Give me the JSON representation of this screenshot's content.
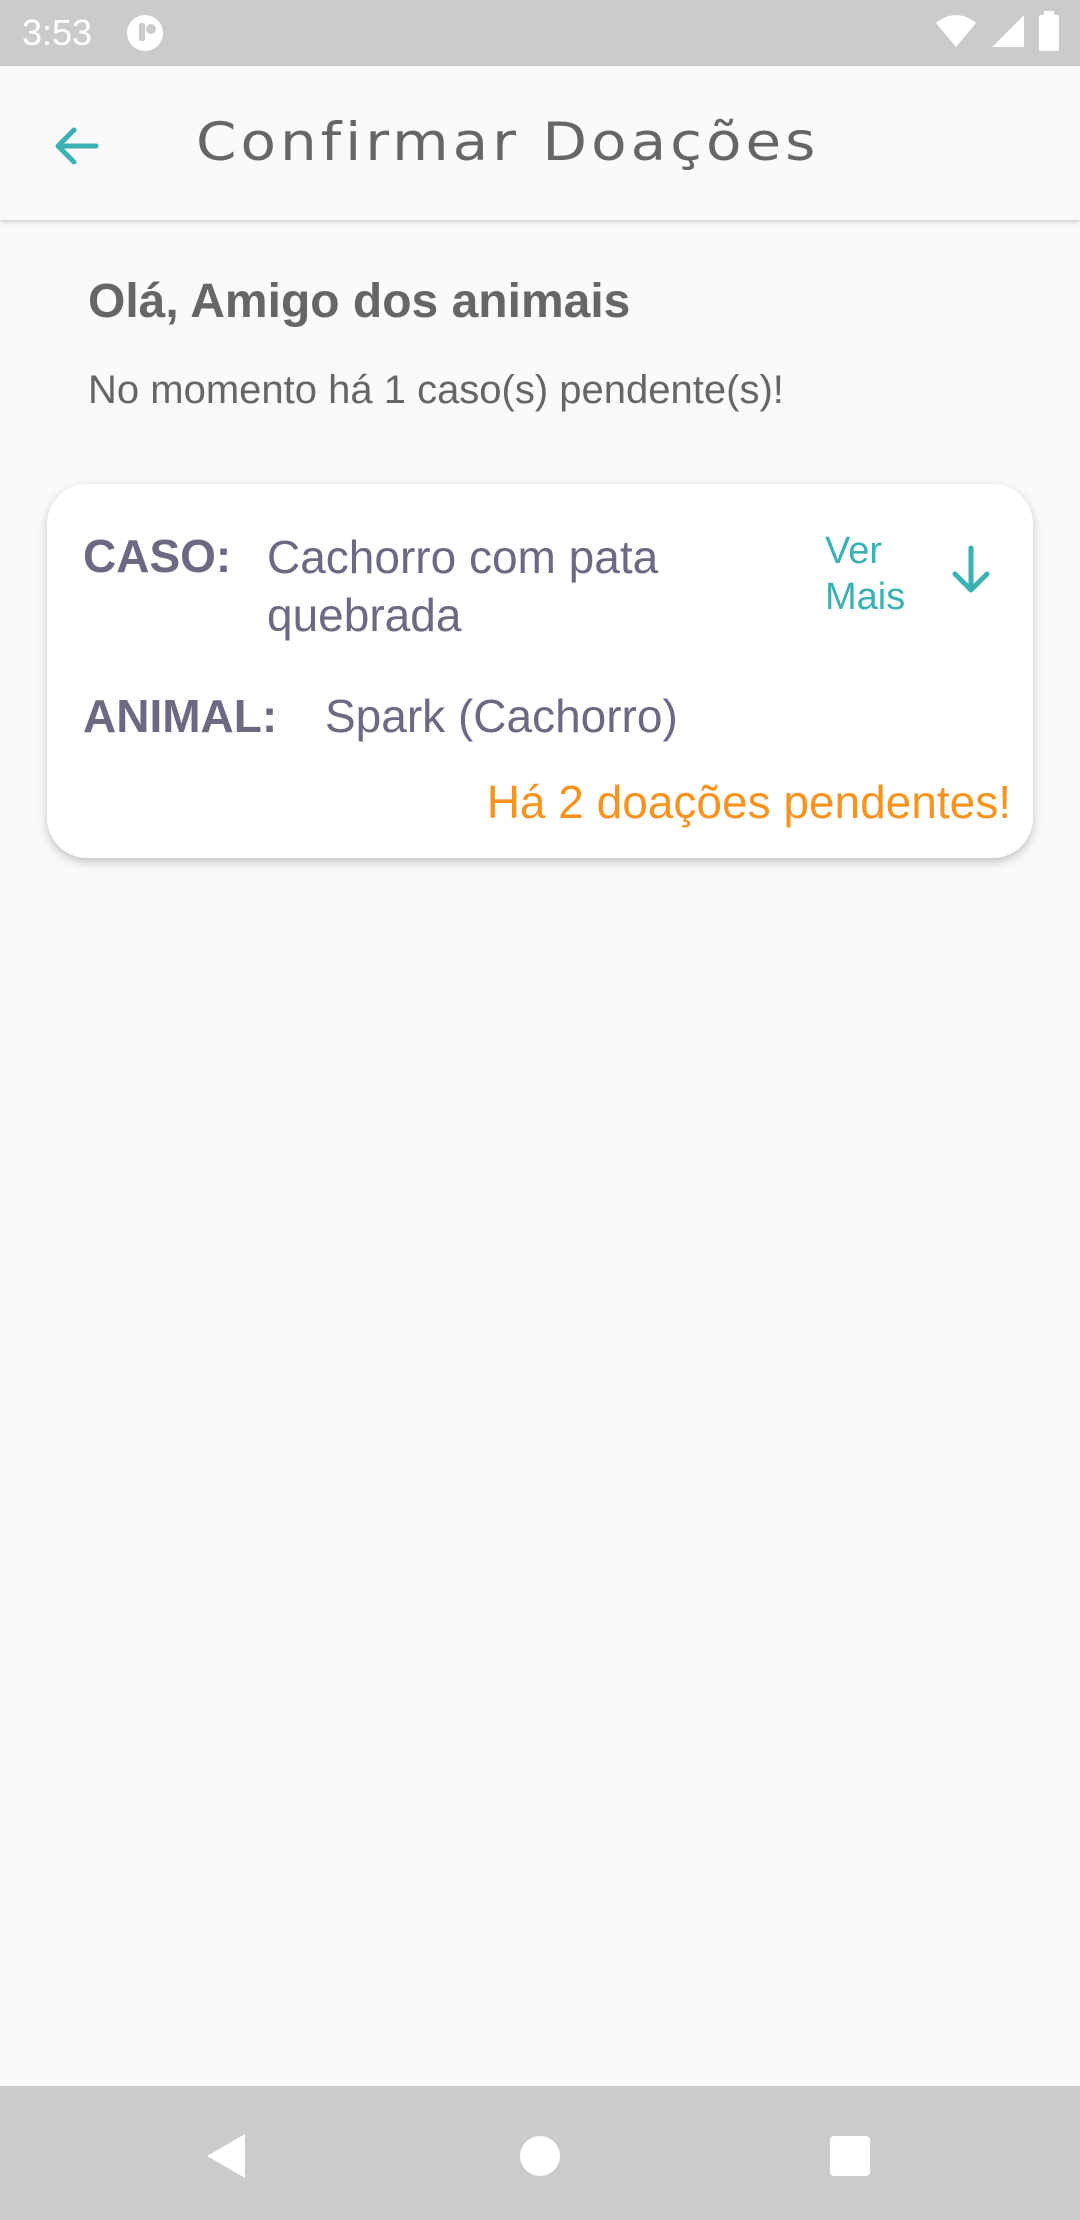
{
  "status_bar": {
    "time": "3:53"
  },
  "header": {
    "title": "Confirmar Doações"
  },
  "greeting": {
    "title": "Olá, Amigo dos animais",
    "subtitle": "No momento há 1 caso(s) pendente(s)!"
  },
  "cases": [
    {
      "case_label": "CASO:",
      "case_value": "Cachorro com pata quebrada",
      "animal_label": "ANIMAL:",
      "animal_value": "Spark (Cachorro)",
      "see_more_label": "Ver Mais",
      "pending_note": "Há 2 doações pendentes!"
    }
  ],
  "colors": {
    "accent": "#3bb1b4",
    "warning": "#f7931e",
    "text_primary": "#666666",
    "card_text": "#6b6a82"
  }
}
